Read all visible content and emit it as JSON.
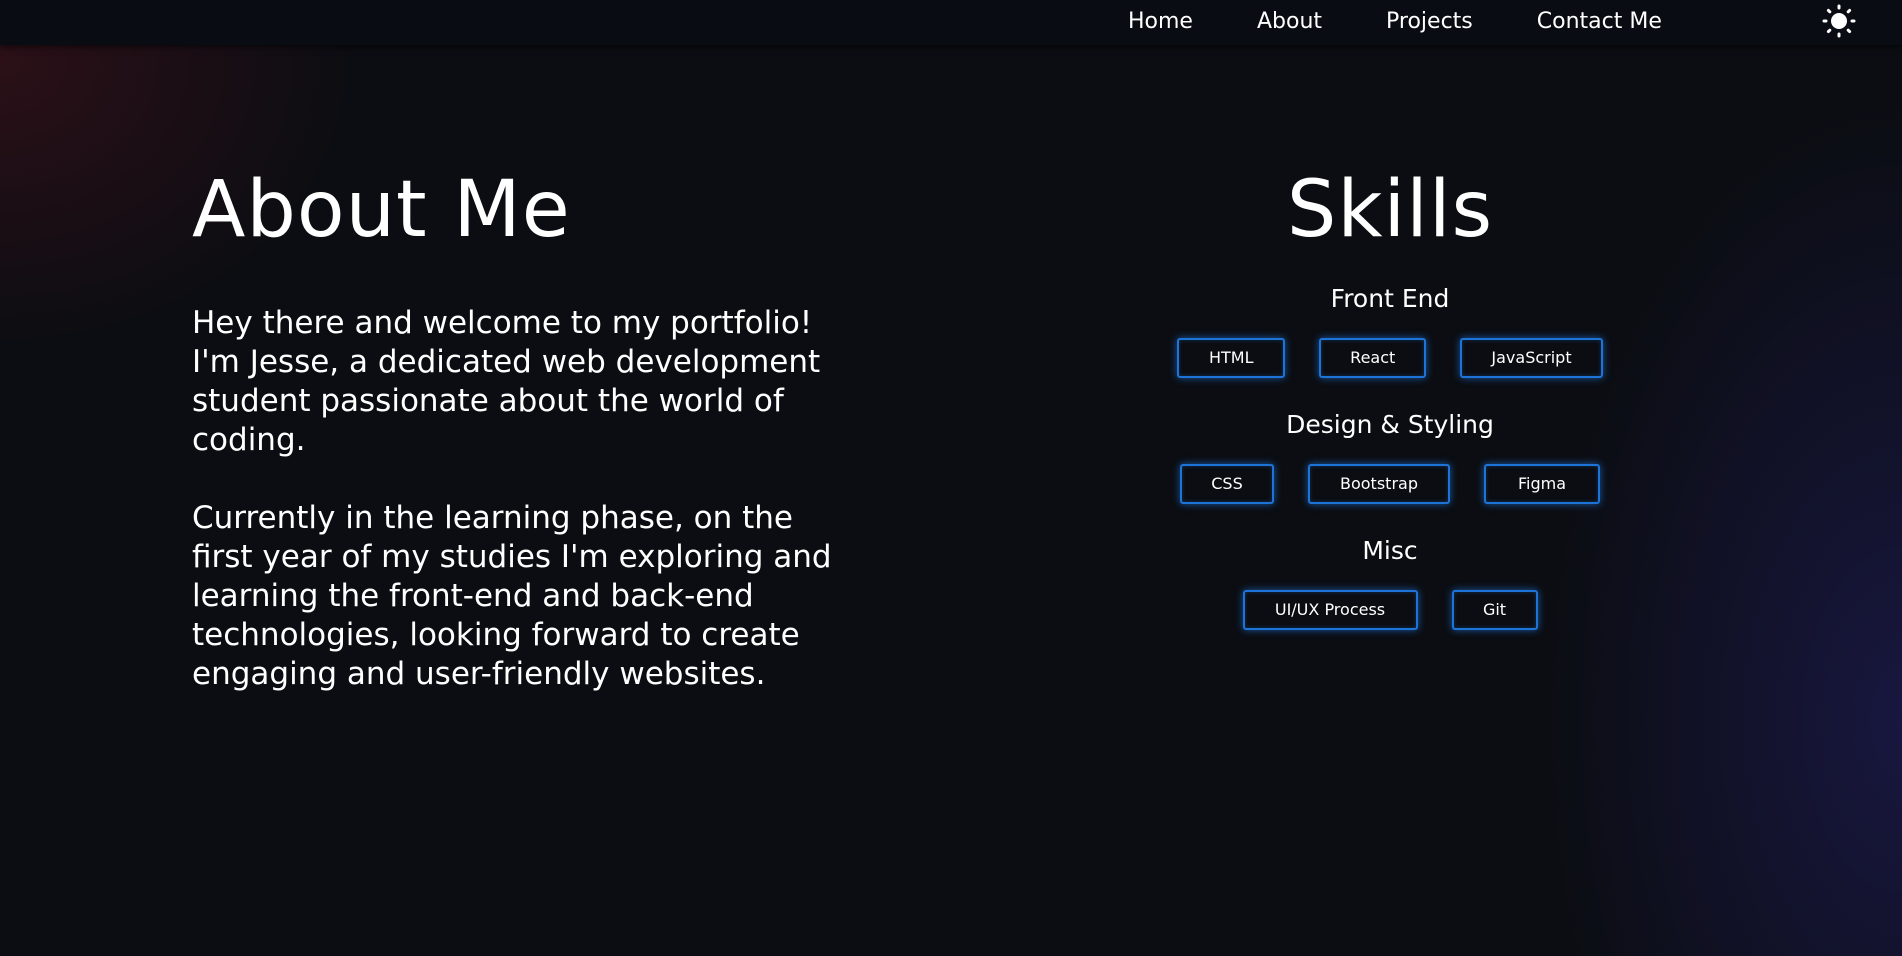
{
  "nav": {
    "links": [
      "Home",
      "About",
      "Projects",
      "Contact Me"
    ],
    "theme_toggle_icon": "sun-icon"
  },
  "about": {
    "title": "About Me",
    "paragraphs": [
      "Hey there and welcome to my portfolio! I'm Jesse, a dedicated web development student passionate about the world of coding.",
      "Currently in the learning phase, on the first year of my studies I'm exploring and learning the front-end and back-end technologies, looking forward to create engaging and user-friendly websites."
    ]
  },
  "skills": {
    "title": "Skills",
    "groups": [
      {
        "title": "Front End",
        "items": [
          "HTML",
          "React",
          "JavaScript"
        ]
      },
      {
        "title": "Design & Styling",
        "items": [
          "CSS",
          "Bootstrap",
          "Figma"
        ]
      },
      {
        "title": "Misc",
        "items": [
          "UI/UX Process",
          "Git"
        ]
      }
    ]
  },
  "colors": {
    "background": "#0b0d12",
    "navbar": "#0a0c13",
    "text": "#ffffff",
    "chip_border": "#1e73d6"
  }
}
